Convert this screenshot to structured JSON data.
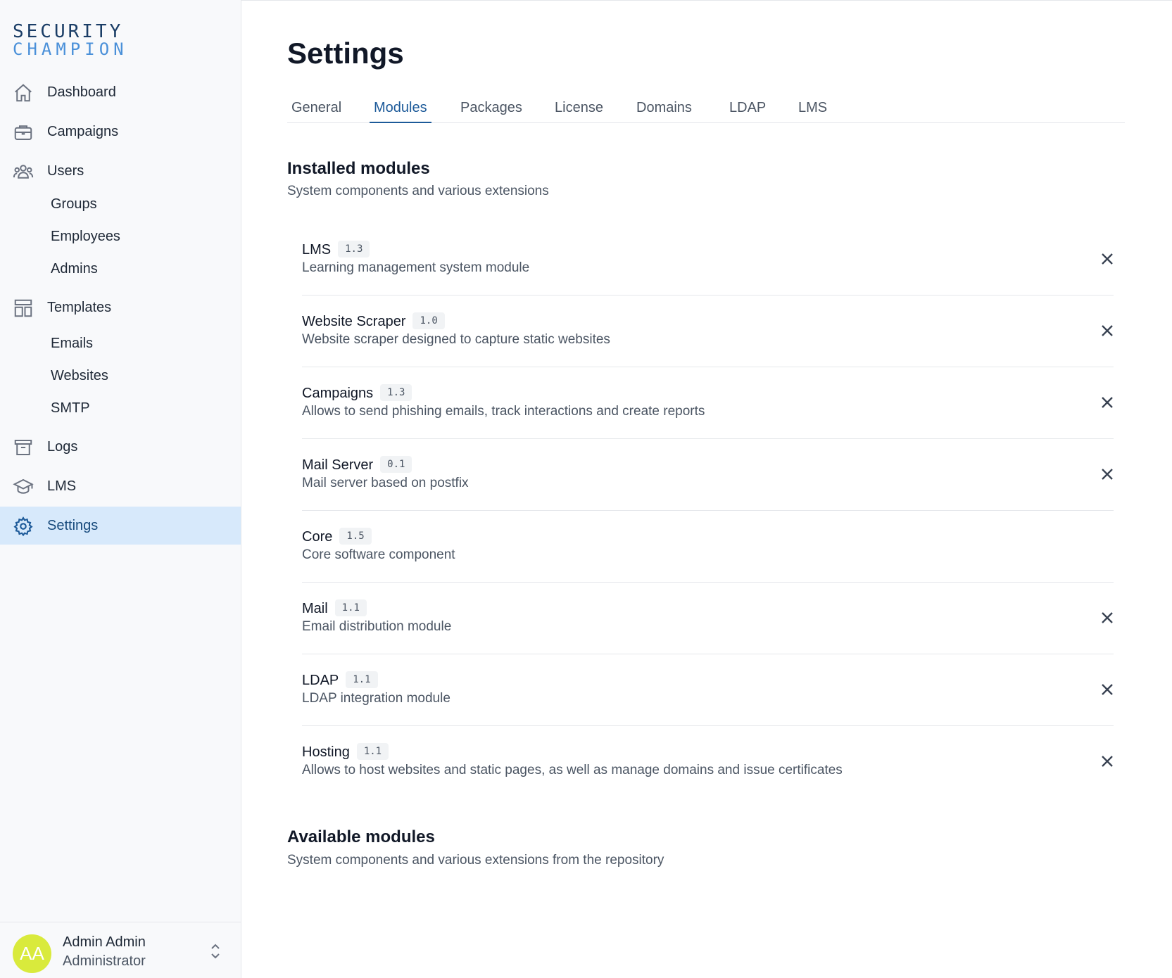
{
  "brand": {
    "logo_line1": "SECURITY",
    "logo_line2": "CHAMPION"
  },
  "sidebar": {
    "items": [
      {
        "label": "Dashboard",
        "icon": "home-icon"
      },
      {
        "label": "Campaigns",
        "icon": "briefcase-icon"
      },
      {
        "label": "Users",
        "icon": "users-icon"
      },
      {
        "label": "Templates",
        "icon": "layout-icon"
      },
      {
        "label": "Logs",
        "icon": "archive-icon"
      },
      {
        "label": "LMS",
        "icon": "graduation-cap-icon"
      },
      {
        "label": "Settings",
        "icon": "gear-icon",
        "active": true
      }
    ],
    "users_sub": [
      "Groups",
      "Employees",
      "Admins"
    ],
    "templates_sub": [
      "Emails",
      "Websites",
      "SMTP"
    ]
  },
  "user": {
    "initials": "AA",
    "name": "Admin Admin",
    "role": "Administrator",
    "avatar_color": "#d9ea3c"
  },
  "page": {
    "title": "Settings"
  },
  "tabs": [
    {
      "label": "General"
    },
    {
      "label": "Modules",
      "active": true
    },
    {
      "label": "Packages"
    },
    {
      "label": "License"
    },
    {
      "label": "Domains"
    },
    {
      "label": "LDAP"
    },
    {
      "label": "LMS"
    }
  ],
  "installed": {
    "title": "Installed modules",
    "subtitle": "System components and various extensions",
    "modules": [
      {
        "name": "LMS",
        "version": "1.3",
        "description": "Learning management system module",
        "removable": true
      },
      {
        "name": "Website Scraper",
        "version": "1.0",
        "description": "Website scraper designed to capture static websites",
        "removable": true
      },
      {
        "name": "Campaigns",
        "version": "1.3",
        "description": "Allows to send phishing emails, track interactions and create reports",
        "removable": true
      },
      {
        "name": "Mail Server",
        "version": "0.1",
        "description": "Mail server based on postfix",
        "removable": true
      },
      {
        "name": "Core",
        "version": "1.5",
        "description": "Core software component",
        "removable": false
      },
      {
        "name": "Mail",
        "version": "1.1",
        "description": "Email distribution module",
        "removable": true
      },
      {
        "name": "LDAP",
        "version": "1.1",
        "description": "LDAP integration module",
        "removable": true
      },
      {
        "name": "Hosting",
        "version": "1.1",
        "description": "Allows to host websites and static pages, as well as manage domains and issue certificates",
        "removable": true
      }
    ]
  },
  "available": {
    "title": "Available modules",
    "subtitle": "System components and various extensions from the repository"
  },
  "colors": {
    "accent": "#1d5a99",
    "active_bg": "#d7e9fb",
    "logo_dark": "#1a3d66",
    "logo_light": "#4a90d9"
  }
}
